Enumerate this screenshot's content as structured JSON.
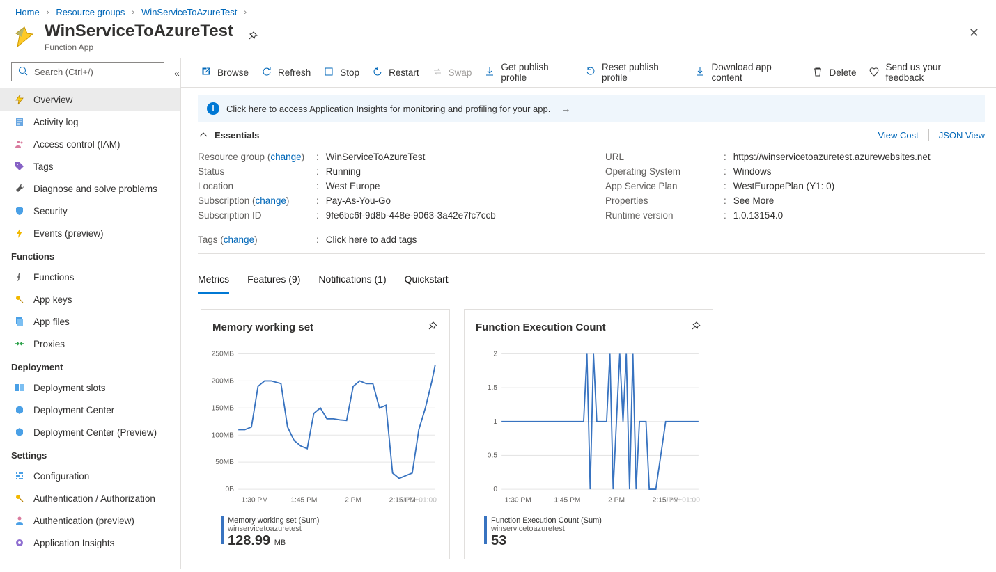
{
  "crumbs": [
    "Home",
    "Resource groups",
    "WinServiceToAzureTest"
  ],
  "title": {
    "name": "WinServiceToAzureTest",
    "sub": "Function App"
  },
  "search": {
    "placeholder": "Search (Ctrl+/)"
  },
  "nav": {
    "topItems": [
      {
        "id": "overview",
        "label": "Overview",
        "icon": "bolt",
        "selected": true
      },
      {
        "id": "activity",
        "label": "Activity log",
        "icon": "log"
      },
      {
        "id": "iam",
        "label": "Access control (IAM)",
        "icon": "people"
      },
      {
        "id": "tags",
        "label": "Tags",
        "icon": "tag"
      },
      {
        "id": "diag",
        "label": "Diagnose and solve problems",
        "icon": "tool"
      },
      {
        "id": "security",
        "label": "Security",
        "icon": "shield"
      },
      {
        "id": "events",
        "label": "Events (preview)",
        "icon": "events"
      }
    ],
    "groups": [
      {
        "title": "Functions",
        "items": [
          {
            "id": "functions",
            "label": "Functions",
            "icon": "fn"
          },
          {
            "id": "appkeys",
            "label": "App keys",
            "icon": "keys"
          },
          {
            "id": "appfiles",
            "label": "App files",
            "icon": "files"
          },
          {
            "id": "proxies",
            "label": "Proxies",
            "icon": "proxies"
          }
        ]
      },
      {
        "title": "Deployment",
        "items": [
          {
            "id": "slots",
            "label": "Deployment slots",
            "icon": "slots"
          },
          {
            "id": "depc",
            "label": "Deployment Center",
            "icon": "depctr"
          },
          {
            "id": "depcp",
            "label": "Deployment Center (Preview)",
            "icon": "depctr"
          }
        ]
      },
      {
        "title": "Settings",
        "items": [
          {
            "id": "config",
            "label": "Configuration",
            "icon": "config"
          },
          {
            "id": "auth",
            "label": "Authentication / Authorization",
            "icon": "key"
          },
          {
            "id": "authp",
            "label": "Authentication (preview)",
            "icon": "authp"
          },
          {
            "id": "appi",
            "label": "Application Insights",
            "icon": "ai"
          }
        ]
      }
    ]
  },
  "toolbar": [
    {
      "id": "browse",
      "label": "Browse",
      "icon": "open"
    },
    {
      "id": "refresh",
      "label": "Refresh",
      "icon": "refresh"
    },
    {
      "id": "stop",
      "label": "Stop",
      "icon": "stop"
    },
    {
      "id": "restart",
      "label": "Restart",
      "icon": "restart"
    },
    {
      "id": "swap",
      "label": "Swap",
      "icon": "swap",
      "disabled": true
    },
    {
      "id": "getpub",
      "label": "Get publish profile",
      "icon": "download"
    },
    {
      "id": "resetpub",
      "label": "Reset publish profile",
      "icon": "reset"
    },
    {
      "id": "dlapp",
      "label": "Download app content",
      "icon": "download"
    },
    {
      "id": "delete",
      "label": "Delete",
      "icon": "trash",
      "class": "del"
    },
    {
      "id": "feedback",
      "label": "Send us your feedback",
      "icon": "heart",
      "class": "heart"
    }
  ],
  "banner": {
    "text": "Click here to access Application Insights for monitoring and profiling for your app."
  },
  "essentials": {
    "headerLinks": {
      "viewCost": "View Cost",
      "json": "JSON View"
    },
    "title": "Essentials",
    "change": "change",
    "left": [
      {
        "label": "Resource group ",
        "change": true,
        "value": "WinServiceToAzureTest",
        "link": true
      },
      {
        "label": "Status",
        "value": "Running"
      },
      {
        "label": "Location",
        "value": "West Europe"
      },
      {
        "label": "Subscription ",
        "change": true,
        "value": "Pay-As-You-Go",
        "link": true
      },
      {
        "label": "Subscription ID",
        "value": "9fe6bc6f-9d8b-448e-9063-3a42e7fc7ccb"
      }
    ],
    "right": [
      {
        "label": "URL",
        "value": "https://winservicetoazuretest.azurewebsites.net",
        "link": true
      },
      {
        "label": "Operating System",
        "value": "Windows"
      },
      {
        "label": "App Service Plan",
        "value": "WestEuropePlan (Y1: 0)",
        "link": true
      },
      {
        "label": "Properties",
        "value": "See More",
        "link": true
      },
      {
        "label": "Runtime version",
        "value": "1.0.13154.0"
      }
    ],
    "tags": {
      "label": "Tags ",
      "change": true,
      "value": "Click here to add tags",
      "link": true
    }
  },
  "pivot": [
    {
      "id": "metrics",
      "label": "Metrics",
      "active": true
    },
    {
      "id": "features",
      "label": "Features (9)"
    },
    {
      "id": "notifications",
      "label": "Notifications (1)"
    },
    {
      "id": "quickstart",
      "label": "Quickstart"
    }
  ],
  "cards": [
    {
      "id": "mem",
      "title": "Memory working set",
      "legend": {
        "l1": "Memory working set (Sum)",
        "l2": "winservicetoazuretest",
        "value": "128.99",
        "unit": "MB"
      },
      "chart": 0
    },
    {
      "id": "count",
      "title": "Function Execution Count",
      "legend": {
        "l1": "Function Execution Count (Sum)",
        "l2": "winservicetoazuretest",
        "value": "53"
      },
      "chart": 1
    }
  ],
  "chart_data": [
    {
      "type": "line",
      "title": "Memory working set",
      "xlabel": "",
      "ylabel": "",
      "ylim": [
        0,
        250
      ],
      "yunit": "MB",
      "yticks": [
        0,
        50,
        100,
        150,
        200,
        250
      ],
      "yticklabels": [
        "0B",
        "50MB",
        "100MB",
        "150MB",
        "200MB",
        "250MB"
      ],
      "xticks": [
        "1:25 PM",
        "1:30 PM",
        "1:45 PM",
        "2 PM",
        "2:15 PM",
        "2:25 PM"
      ],
      "xticklabels_visible": [
        "1:30 PM",
        "1:45 PM",
        "2 PM",
        "2:15 PM"
      ],
      "tz": "UTC+01:00",
      "series": [
        {
          "name": "Memory working set (Sum)",
          "color": "#3873c0",
          "x": [
            "1:25",
            "1:27",
            "1:29",
            "1:31",
            "1:33",
            "1:35",
            "1:38",
            "1:40",
            "1:42",
            "1:44",
            "1:46",
            "1:48",
            "1:50",
            "1:52",
            "1:54",
            "1:56",
            "1:58",
            "2:00",
            "2:02",
            "2:04",
            "2:06",
            "2:08",
            "2:10",
            "2:12",
            "2:14",
            "2:16",
            "2:18",
            "2:20",
            "2:22",
            "2:24",
            "2:25"
          ],
          "y": [
            110,
            110,
            115,
            190,
            200,
            200,
            195,
            115,
            90,
            80,
            75,
            140,
            150,
            130,
            130,
            128,
            127,
            190,
            200,
            195,
            195,
            150,
            155,
            30,
            20,
            25,
            30,
            110,
            150,
            200,
            230
          ]
        }
      ]
    },
    {
      "type": "line",
      "title": "Function Execution Count",
      "xlabel": "",
      "ylabel": "",
      "ylim": [
        0,
        2
      ],
      "yticks": [
        0,
        0.5,
        1,
        1.5,
        2
      ],
      "yticklabels": [
        "0",
        "0.5",
        "1",
        "1.5",
        "2"
      ],
      "xticks": [
        "1:25 PM",
        "1:30 PM",
        "1:45 PM",
        "2 PM",
        "2:15 PM",
        "2:25 PM"
      ],
      "xticklabels_visible": [
        "1:30 PM",
        "1:45 PM",
        "2 PM",
        "2:15 PM"
      ],
      "tz": "UTC+01:00",
      "series": [
        {
          "name": "Function Execution Count (Sum)",
          "color": "#3873c0",
          "x": [
            "1:25",
            "1:30",
            "1:45",
            "1:50",
            "1:51",
            "1:52",
            "1:53",
            "1:54",
            "1:55",
            "1:57",
            "1:58",
            "1:59",
            "2:01",
            "2:02",
            "2:03",
            "2:04",
            "2:05",
            "2:06",
            "2:07",
            "2:09",
            "2:10",
            "2:11",
            "2:12",
            "2:15",
            "2:22",
            "2:23",
            "2:25"
          ],
          "y": [
            1,
            1,
            1,
            1,
            2,
            0,
            2,
            1,
            1,
            1,
            2,
            0,
            2,
            1,
            2,
            0,
            2,
            0,
            1,
            1,
            0,
            0,
            0,
            1,
            1,
            1,
            1
          ]
        }
      ]
    }
  ]
}
